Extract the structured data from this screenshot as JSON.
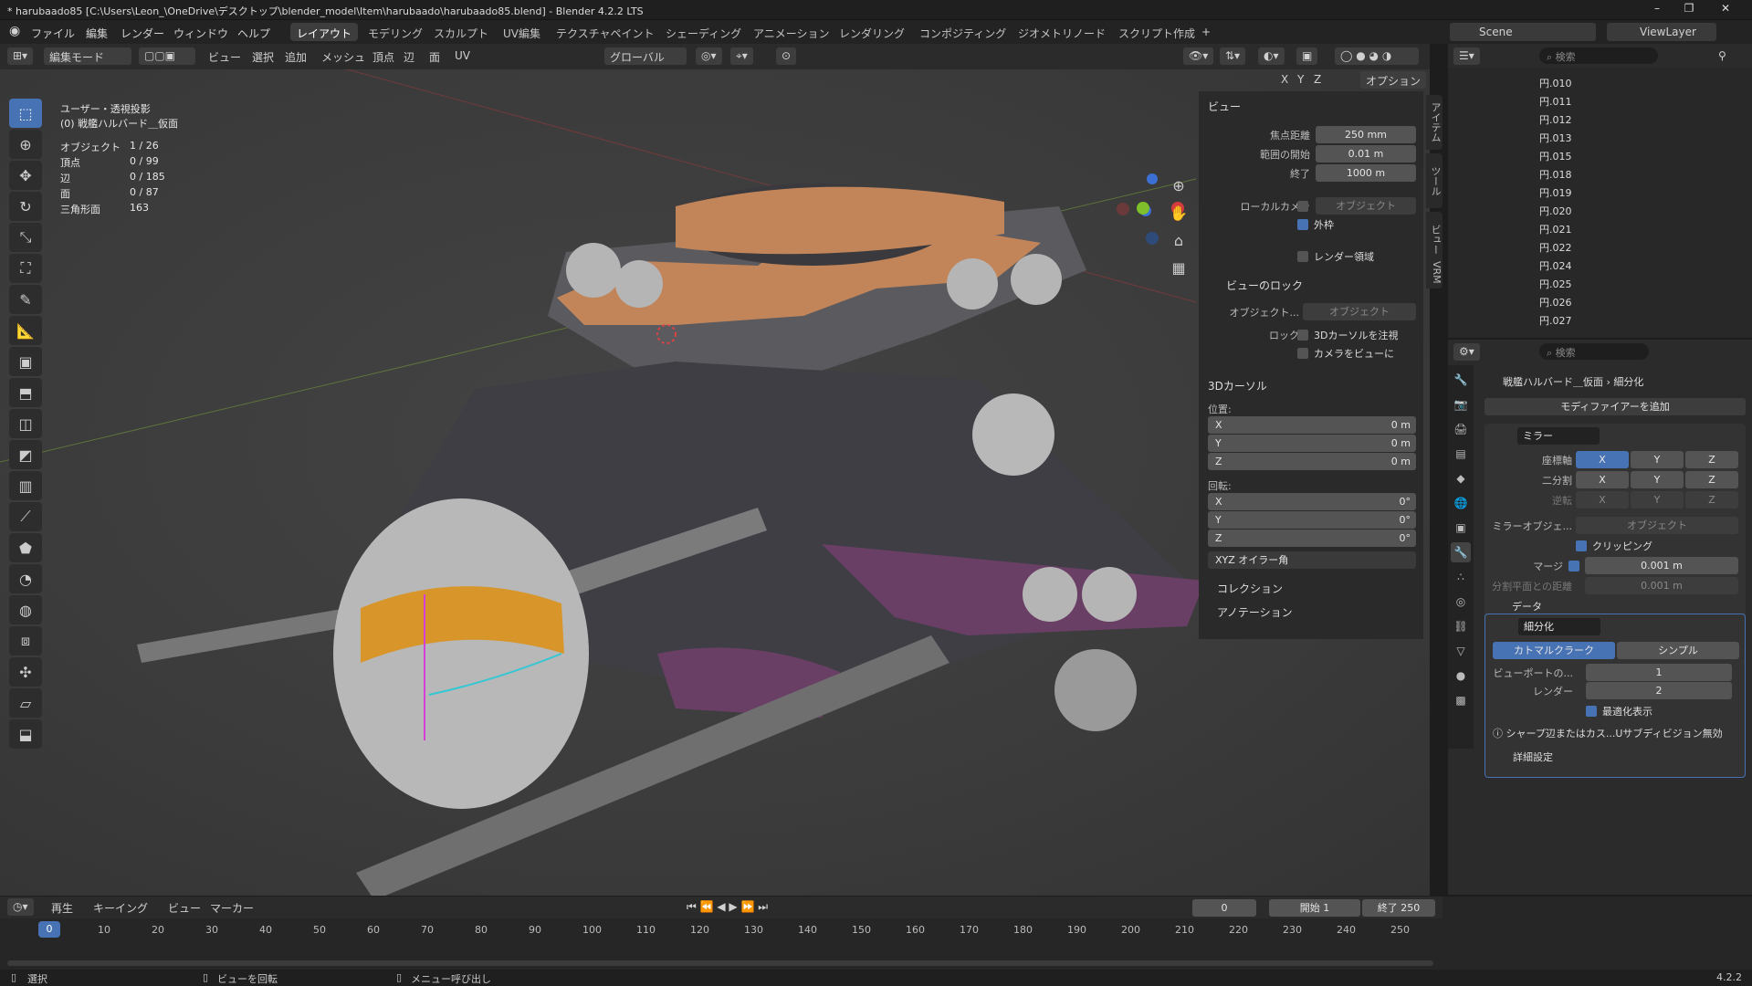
{
  "titlebar": {
    "text": "* harubaado85 [C:\\Users\\Leon_\\OneDrive\\デスクトップ\\blender_model\\Item\\harubaado\\harubaado85.blend] - Blender 4.2.2 LTS"
  },
  "menu": [
    "ファイル",
    "編集",
    "レンダー",
    "ウィンドウ",
    "ヘルプ"
  ],
  "workspaces": [
    "レイアウト",
    "モデリング",
    "スカルプト",
    "UV編集",
    "テクスチャペイント",
    "シェーディング",
    "アニメーション",
    "レンダリング",
    "コンポジティング",
    "ジオメトリノード",
    "スクリプト作成"
  ],
  "top_right": {
    "scene": "Scene",
    "viewlayer": "ViewLayer"
  },
  "header": {
    "mode": "編集モード",
    "menus": [
      "ビュー",
      "選択",
      "追加",
      "メッシュ",
      "頂点",
      "辺",
      "面",
      "UV"
    ],
    "transform": "グローバル",
    "options": "オプション",
    "axes": [
      "X",
      "Y",
      "Z"
    ]
  },
  "overlay": {
    "view": "ユーザー・透視投影",
    "object": "(0) 戦艦ハルバード＿仮面",
    "stats": [
      {
        "k": "オブジェクト",
        "v": "1 / 26"
      },
      {
        "k": "頂点",
        "v": "0 / 99"
      },
      {
        "k": "辺",
        "v": "0 / 185"
      },
      {
        "k": "面",
        "v": "0 / 87"
      },
      {
        "k": "三角形面",
        "v": "163"
      }
    ]
  },
  "npanel": {
    "view_title": "ビュー",
    "focal_label": "焦点距離",
    "focal": "250 mm",
    "clip_start_label": "範囲の開始",
    "clip_start": "0.01 m",
    "clip_end_label": "終了",
    "clip_end": "1000 m",
    "local_camera_label": "ローカルカメラ",
    "object_placeholder": "オブジェクト",
    "outline_label": "外枠",
    "render_region_label": "レンダー領域",
    "view_lock_title": "ビューのロック",
    "lock_object_label": "オブジェクト...",
    "lock_label": "ロック",
    "lock_cursor": "3Dカーソルを注視",
    "camera_to_view": "カメラをビューに",
    "cursor_title": "3Dカーソル",
    "location_label": "位置:",
    "rotation_label": "回転:",
    "loc": [
      {
        "a": "X",
        "v": "0 m"
      },
      {
        "a": "Y",
        "v": "0 m"
      },
      {
        "a": "Z",
        "v": "0 m"
      }
    ],
    "rot": [
      {
        "a": "X",
        "v": "0°"
      },
      {
        "a": "Y",
        "v": "0°"
      },
      {
        "a": "Z",
        "v": "0°"
      }
    ],
    "rot_mode": "XYZ オイラー角",
    "collection": "コレクション",
    "annotation": "アノテーション",
    "tabs": [
      "アイテム",
      "ツール",
      "ビュー",
      "VRM"
    ]
  },
  "outliner": {
    "search": "検索",
    "items": [
      "円.010",
      "円.011",
      "円.012",
      "円.013",
      "円.015",
      "円.018",
      "円.019",
      "円.020",
      "円.021",
      "円.022",
      "円.024",
      "円.025",
      "円.026",
      "円.027"
    ]
  },
  "properties": {
    "search": "検索",
    "breadcrumb_obj": "戦艦ハルバード＿仮面",
    "breadcrumb_mod": "細分化",
    "add_modifier": "モディファイアーを追加",
    "mirror": {
      "name": "ミラー",
      "axis_label": "座標軸",
      "bisect_label": "二分割",
      "flip_label": "逆転",
      "mirror_obj_label": "ミラーオブジェ...",
      "obj_placeholder": "オブジェクト",
      "clipping": "クリッピング",
      "merge_label": "マージ",
      "merge": "0.001 m",
      "bisect_dist_label": "分割平面との距離",
      "bisect_dist": "0.001 m",
      "data": "データ"
    },
    "subsurf": {
      "name": "細分化",
      "catmull": "カトマルクラーク",
      "simple": "シンプル",
      "viewport_label": "ビューポートの...",
      "viewport": "1",
      "render_label": "レンダー",
      "render": "2",
      "optimal": "最適化表示",
      "warning": "シャープ辺またはカス...Uサブディビジョン無効",
      "advanced": "詳細設定"
    }
  },
  "timeline": {
    "menus": [
      "再生",
      "キーイング",
      "ビュー",
      "マーカー"
    ],
    "current": "0",
    "start_label": "開始",
    "start": "1",
    "end_label": "終了",
    "end": "250",
    "ticks": [
      "0",
      "10",
      "20",
      "30",
      "40",
      "50",
      "60",
      "70",
      "80",
      "90",
      "100",
      "110",
      "120",
      "130",
      "140",
      "150",
      "160",
      "170",
      "180",
      "190",
      "200",
      "210",
      "220",
      "230",
      "240",
      "250"
    ]
  },
  "statusbar": {
    "select": "選択",
    "rotate": "ビューを回転",
    "menu": "メニュー呼び出し",
    "version": "4.2.2"
  }
}
